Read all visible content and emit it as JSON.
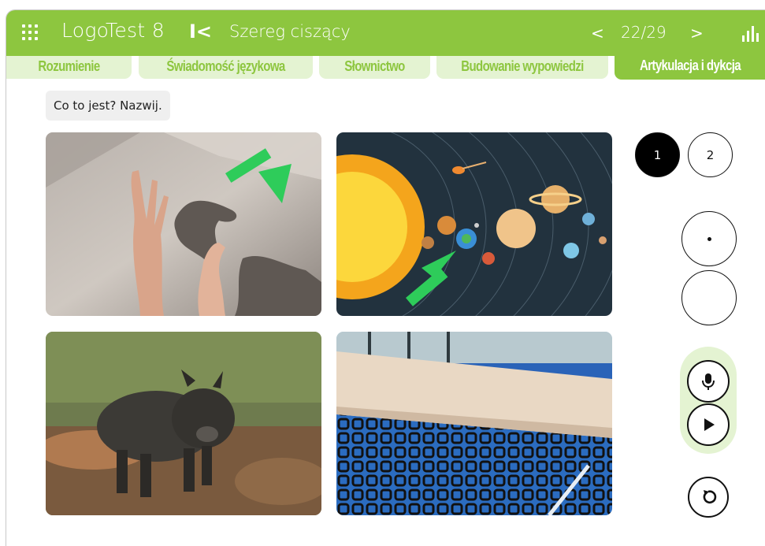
{
  "header": {
    "app_title": "LogoTest 8",
    "test_name": "Szereg ciszący",
    "page_counter": "22/29",
    "prev": "<",
    "next": ">",
    "first": "I<"
  },
  "tabs": [
    {
      "label": "Rozumienie",
      "active": false
    },
    {
      "label": "Świadomość językowa",
      "active": false
    },
    {
      "label": "Słownictwo",
      "active": false
    },
    {
      "label": "Budowanie wypowiedzi",
      "active": false
    },
    {
      "label": "Artykulacja i dykcja",
      "active": true
    }
  ],
  "instruction": "Co to jest? Nazwij.",
  "photos": [
    "shadow-hands-photo",
    "solar-system-photo",
    "wild-boar-photo",
    "tennis-net-photo"
  ],
  "pagination": {
    "page1": "1",
    "page2": "2",
    "active": 1
  },
  "colors": {
    "brand_green": "#8dc63f",
    "tab_light": "#e4f3d2",
    "arrow_green": "#2ecc5a"
  },
  "icons": [
    "grid-icon",
    "first-page-icon",
    "stats-icon",
    "microphone-icon",
    "play-icon",
    "reset-icon"
  ]
}
